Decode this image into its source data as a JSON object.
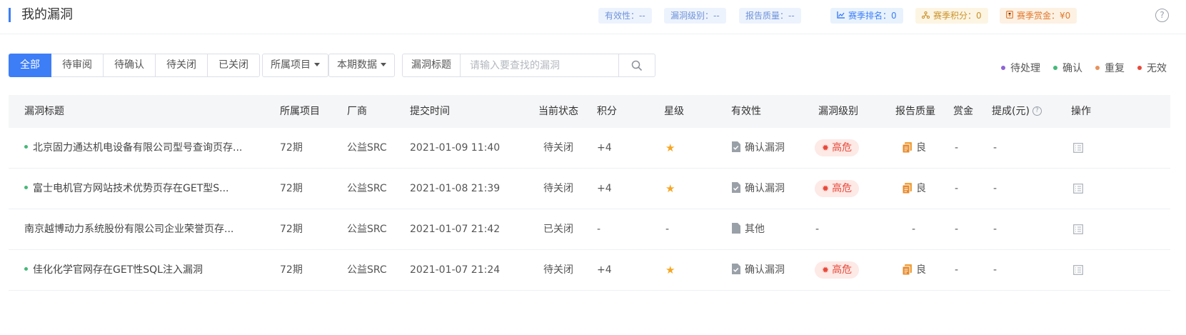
{
  "header": {
    "title": "我的漏洞",
    "stats": {
      "validity": "有效性：--",
      "level": "漏洞级别：--",
      "quality": "报告质量：--",
      "season_rank": "赛季排名：0",
      "season_score": "赛季积分：0",
      "season_bounty": "赛季赏金：¥0"
    },
    "help": "?"
  },
  "filters": {
    "tabs": [
      "全部",
      "待审阅",
      "待确认",
      "待关闭",
      "已关闭"
    ],
    "active_tab": "全部",
    "project_dropdown": "所属项目",
    "period_dropdown": "本期数据",
    "search_label": "漏洞标题",
    "search_placeholder": "请输入要查找的漏洞",
    "search_value": ""
  },
  "legend": [
    {
      "label": "待处理",
      "color": "#8e63d6"
    },
    {
      "label": "确认",
      "color": "#46b879"
    },
    {
      "label": "重复",
      "color": "#e8925b"
    },
    {
      "label": "无效",
      "color": "#e8493a"
    }
  ],
  "table": {
    "columns": [
      "漏洞标题",
      "所属项目",
      "厂商",
      "提交时间",
      "当前状态",
      "积分",
      "星级",
      "有效性",
      "漏洞级别",
      "报告质量",
      "赏金",
      "提成(元)",
      "操作"
    ],
    "rows": [
      {
        "title": "北京固力通达机电设备有限公司型号查询页存...",
        "dot": true,
        "project": "72期",
        "vendor": "公益SRC",
        "time": "2021-01-09 11:40",
        "status": "待关闭",
        "score": "+4",
        "star": "★",
        "validity": "确认漏洞",
        "level": "高危",
        "quality": "良",
        "bounty": "-",
        "commission": "-"
      },
      {
        "title": "富士电机官方网站技术优势页存在GET型S...",
        "dot": true,
        "project": "72期",
        "vendor": "公益SRC",
        "time": "2021-01-08 21:39",
        "status": "待关闭",
        "score": "+4",
        "star": "★",
        "validity": "确认漏洞",
        "level": "高危",
        "quality": "良",
        "bounty": "-",
        "commission": "-"
      },
      {
        "title": "南京越博动力系统股份有限公司企业荣誉页存...",
        "dot": false,
        "project": "72期",
        "vendor": "公益SRC",
        "time": "2021-01-07 21:42",
        "status": "已关闭",
        "score": "-",
        "star": "-",
        "validity": "其他",
        "level": "-",
        "quality": "-",
        "bounty": "-",
        "commission": "-"
      },
      {
        "title": "佳化化学官网存在GET性SQL注入漏洞",
        "dot": true,
        "project": "72期",
        "vendor": "公益SRC",
        "time": "2021-01-07 21:24",
        "status": "待关闭",
        "score": "+4",
        "star": "★",
        "validity": "确认漏洞",
        "level": "高危",
        "quality": "良",
        "bounty": "-",
        "commission": "-"
      }
    ]
  }
}
